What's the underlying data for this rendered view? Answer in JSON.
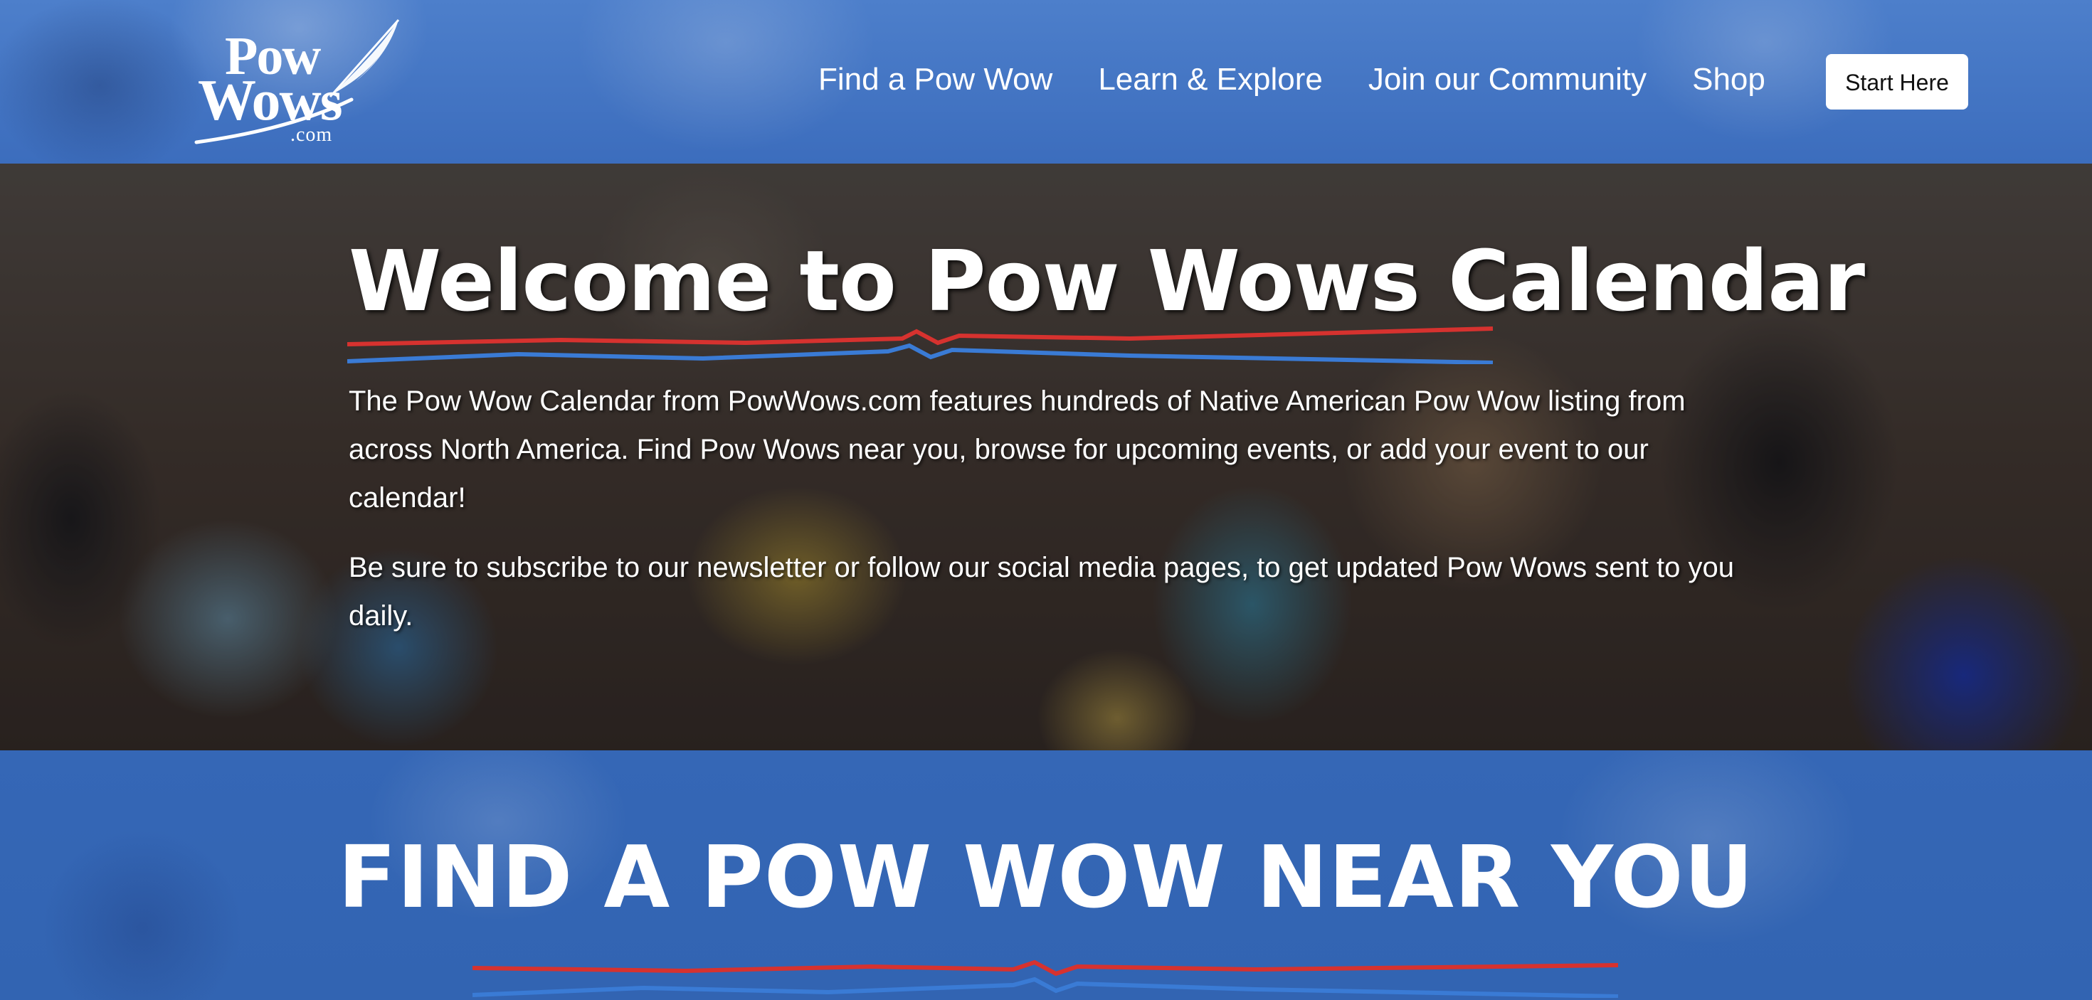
{
  "header": {
    "logo": {
      "line1": "Pow",
      "line2": "Wows",
      "suffix": ".com",
      "icon": "feather-icon"
    },
    "nav": [
      {
        "label": "Find a Pow Wow"
      },
      {
        "label": "Learn & Explore"
      },
      {
        "label": "Join our Community"
      },
      {
        "label": "Shop"
      }
    ],
    "cta_label": "Start Here"
  },
  "hero": {
    "title": "Welcome to Pow Wows Calendar",
    "paragraphs": [
      "The Pow Wow Calendar from PowWows.com features hundreds of Native American Pow Wow listing from across North America. Find Pow Wows near you, browse for upcoming events, or add your event to our calendar!",
      "Be sure to subscribe to our newsletter or follow our social media pages, to get updated Pow Wows sent to you daily."
    ]
  },
  "find_section": {
    "title": "FIND A POW WOW NEAR YOU"
  },
  "colors": {
    "brand_blue": "#3c6dbd",
    "divider_red": "#d6322f",
    "divider_blue": "#3a7bd5",
    "button_bg": "#ffffff"
  }
}
